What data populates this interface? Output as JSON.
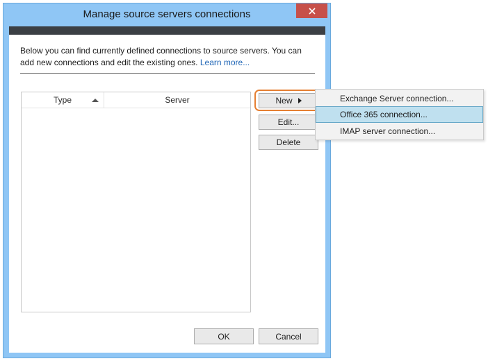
{
  "window": {
    "title": "Manage source servers connections"
  },
  "description": {
    "text": "Below you can find currently defined connections to source servers. You can add new connections and edit the existing ones. ",
    "link_text": "Learn more..."
  },
  "list": {
    "columns": [
      "Type",
      "Server"
    ],
    "sorted_column": "Type",
    "sort_direction": "ascending",
    "rows": []
  },
  "buttons": {
    "new_label": "New",
    "edit_label": "Edit...",
    "delete_label": "Delete",
    "ok_label": "OK",
    "cancel_label": "Cancel"
  },
  "new_menu": {
    "items": [
      "Exchange Server connection...",
      "Office 365 connection...",
      "IMAP server connection..."
    ],
    "highlighted_index": 1
  },
  "colors": {
    "title_bar": "#8fc6f5",
    "close_button": "#c7504a",
    "highlight_ring": "#e57f32",
    "menu_hover": "#bfe0ef",
    "link": "#1d64b5"
  },
  "icons": {
    "close": "close-icon",
    "sort": "sort-up-icon",
    "submenu": "play-icon"
  }
}
